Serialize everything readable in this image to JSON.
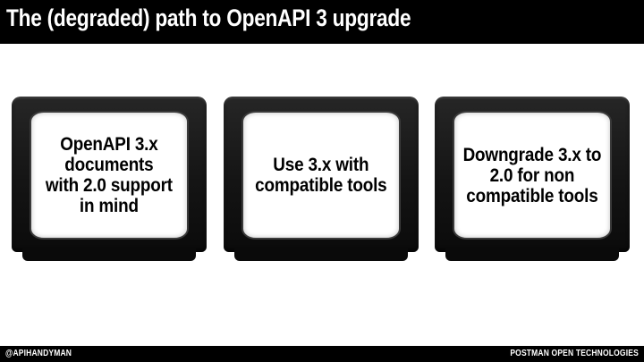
{
  "slide": {
    "title": "The (degraded) path to OpenAPI 3 upgrade"
  },
  "cards": [
    {
      "lines": [
        "OpenAPI 3.x",
        "documents",
        "with 2.0 support",
        "in mind"
      ],
      "icon": "crt-tv-icon"
    },
    {
      "lines": [
        "Use 3.x with",
        "compatible tools"
      ],
      "icon": "crt-tv-icon"
    },
    {
      "lines": [
        "Downgrade 3.x to",
        "2.0 for non",
        "compatible tools"
      ],
      "icon": "crt-tv-icon"
    }
  ],
  "footer": {
    "handle": "@APIHANDYMAN",
    "brand": "POSTMAN OPEN TECHNOLOGIES"
  },
  "colors": {
    "bar": "#000000",
    "background": "#ffffff",
    "tv_body": "#141414"
  }
}
